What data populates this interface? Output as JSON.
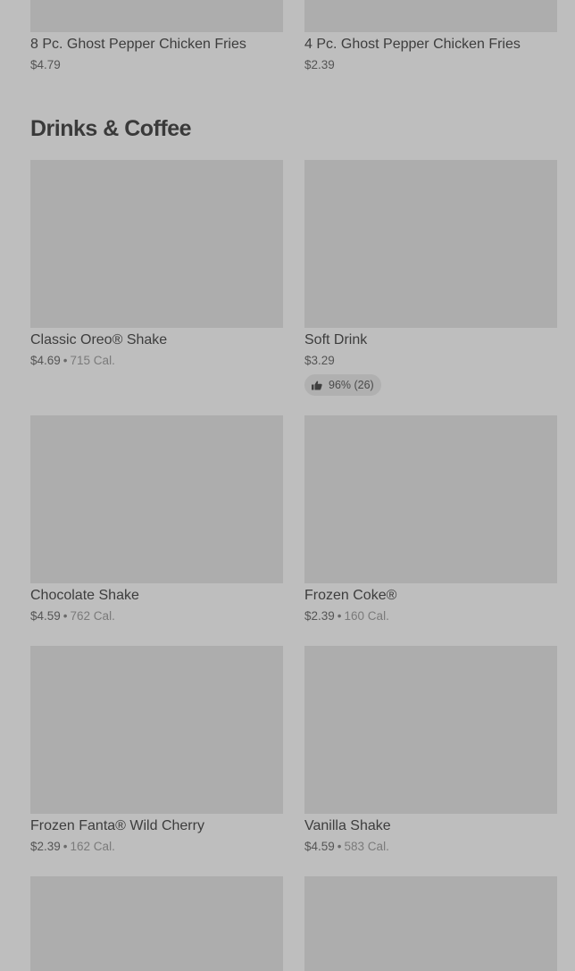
{
  "top_items": [
    {
      "name": "8 Pc. Ghost Pepper Chicken Fries",
      "price": "$4.79"
    },
    {
      "name": "4 Pc. Ghost Pepper Chicken Fries",
      "price": "$2.39"
    }
  ],
  "section": {
    "title": "Drinks & Coffee"
  },
  "items": [
    {
      "name": "Classic Oreo® Shake",
      "price": "$4.69",
      "cal": "715 Cal."
    },
    {
      "name": "Soft Drink",
      "price": "$3.29",
      "rating": "96% (26)"
    },
    {
      "name": "Chocolate Shake",
      "price": "$4.59",
      "cal": "762 Cal."
    },
    {
      "name": "Frozen Coke®",
      "price": "$2.39",
      "cal": "160 Cal."
    },
    {
      "name": "Frozen Fanta® Wild Cherry",
      "price": "$2.39",
      "cal": "162 Cal."
    },
    {
      "name": "Vanilla Shake",
      "price": "$4.59",
      "cal": "583 Cal."
    }
  ],
  "separator": "•",
  "icons": {
    "rating": "thumbs-up-icon"
  }
}
